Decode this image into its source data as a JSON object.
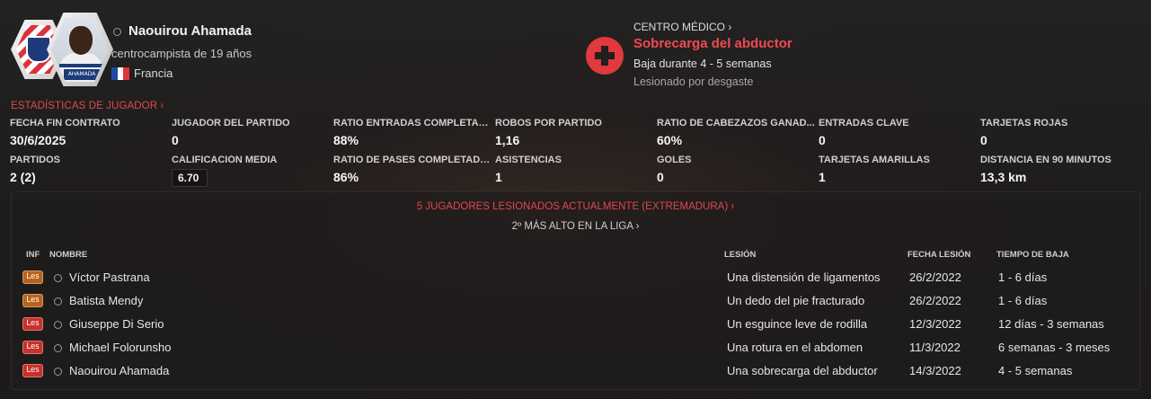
{
  "player": {
    "name": "Naouirou Ahamada",
    "role": "centrocampista de 19 años",
    "nation": "Francia",
    "flag_colors": [
      "#1f47a8",
      "#ffffff",
      "#e0353b"
    ],
    "photo_nameplate": "AHAMADA"
  },
  "medical": {
    "link": "CENTRO MÉDICO",
    "injury": "Sobrecarga del abductor",
    "duration": "Baja durante 4 - 5 semanas",
    "cause": "Lesionado por desgaste",
    "icon": "medical-cross-icon",
    "accent": "#e0393e"
  },
  "stats_link": "ESTADÍSTICAS DE JUGADOR",
  "stats": [
    {
      "label": "FECHA FIN CONTRATO",
      "value": "30/6/2025"
    },
    {
      "label": "JUGADOR DEL PARTIDO",
      "value": "0"
    },
    {
      "label": "RATIO ENTRADAS COMPLETAD...",
      "value": "88%"
    },
    {
      "label": "ROBOS POR PARTIDO",
      "value": "1,16"
    },
    {
      "label": "RATIO DE CABEZAZOS GANAD...",
      "value": "60%"
    },
    {
      "label": "ENTRADAS CLAVE",
      "value": "0"
    },
    {
      "label": "TARJETAS ROJAS",
      "value": "0"
    },
    {
      "label": "PARTIDOS",
      "value": "2 (2)"
    },
    {
      "label": "CALIFICACIÓN MEDIA",
      "value": "6.70"
    },
    {
      "label": "RATIO DE PASES COMPLETADOS",
      "value": "86%"
    },
    {
      "label": "ASISTENCIAS",
      "value": "1"
    },
    {
      "label": "GOLES",
      "value": "0"
    },
    {
      "label": "TARJETAS AMARILLAS",
      "value": "1"
    },
    {
      "label": "DISTANCIA EN 90 MINUTOS",
      "value": "13,3 km"
    }
  ],
  "injured": {
    "title": "5 JUGADORES LESIONADOS ACTUALMENTE (EXTREMADURA)",
    "subtitle": "2º MÁS ALTO EN LA LIGA",
    "columns": {
      "inf": "INF",
      "name": "NOMBRE",
      "injury": "LESIÓN",
      "date": "FECHA LESIÓN",
      "time": "TIEMPO DE BAJA"
    },
    "rows": [
      {
        "badge": "Les",
        "badge_color": "#b8631a",
        "name": "Víctor Pastrana",
        "injury": "Una distensión de ligamentos",
        "date": "26/2/2022",
        "time": "1 - 6 días"
      },
      {
        "badge": "Les",
        "badge_color": "#b8631a",
        "name": "Batista Mendy",
        "injury": "Un dedo del pie fracturado",
        "date": "26/2/2022",
        "time": "1 - 6 días"
      },
      {
        "badge": "Les",
        "badge_color": "#c9302c",
        "name": "Giuseppe Di Serio",
        "injury": "Un esguince leve de rodilla",
        "date": "12/3/2022",
        "time": "12 días - 3 semanas"
      },
      {
        "badge": "Les",
        "badge_color": "#c9302c",
        "name": "Michael Folorunsho",
        "injury": "Una rotura en el abdomen",
        "date": "11/3/2022",
        "time": "6 semanas - 3 meses"
      },
      {
        "badge": "Les",
        "badge_color": "#c9302c",
        "name": "Naouirou Ahamada",
        "injury": "Una sobrecarga del abductor",
        "date": "14/3/2022",
        "time": "4 - 5 semanas"
      }
    ]
  }
}
